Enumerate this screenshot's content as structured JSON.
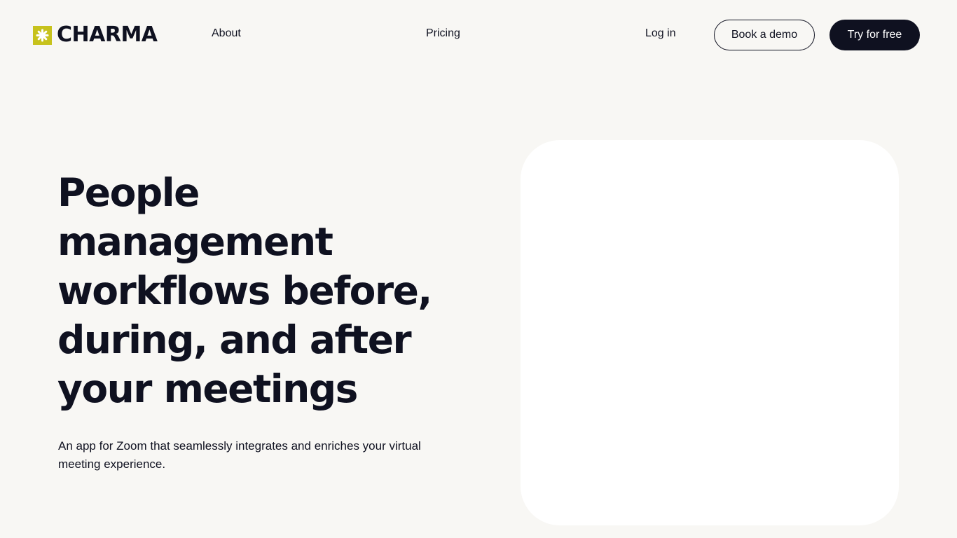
{
  "header": {
    "logo_text": "CHARMA",
    "nav": {
      "about": "About",
      "pricing": "Pricing",
      "login": "Log in"
    },
    "buttons": {
      "book_demo": "Book a demo",
      "try_free": "Try for free"
    }
  },
  "hero": {
    "title_lines": [
      "People",
      "management",
      "workflows before,",
      "during, and after",
      "your meetings"
    ],
    "subtitle": "An app for Zoom that seamlessly integrates and enriches your virtual meeting experience."
  },
  "colors": {
    "background": "#f8f7f4",
    "text": "#0f1120",
    "logo_accent": "#c7c21c",
    "card": "#ffffff"
  }
}
